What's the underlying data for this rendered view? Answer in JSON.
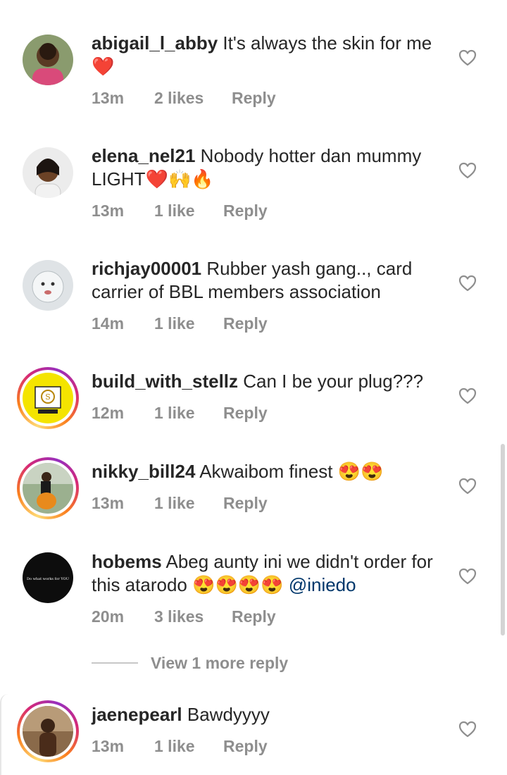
{
  "comments": [
    {
      "username": "abigail_l_abby",
      "text": " It's always the skin for me❤️",
      "time": "13m",
      "likes": "2 likes",
      "reply": "Reply"
    },
    {
      "username": "elena_nel21",
      "text": " Nobody hotter dan mummy LIGHT❤️🙌🔥",
      "time": "13m",
      "likes": "1 like",
      "reply": "Reply"
    },
    {
      "username": "richjay00001",
      "text": " Rubber yash gang.., card carrier of BBL members association",
      "time": "14m",
      "likes": "1 like",
      "reply": "Reply"
    },
    {
      "username": "build_with_stellz",
      "text": " Can I be your plug???",
      "time": "12m",
      "likes": "1 like",
      "reply": "Reply"
    },
    {
      "username": "nikky_bill24",
      "text": " Akwaibom finest 😍😍",
      "time": "13m",
      "likes": "1 like",
      "reply": "Reply"
    },
    {
      "username": "hobems",
      "text": " Abeg aunty ini we didn't order for this atarodo 😍😍😍😍 ",
      "mention": "@iniedo",
      "time": "20m",
      "likes": "3 likes",
      "reply": "Reply",
      "avatar_text": "Do what works for YOU"
    },
    {
      "username": "jaenepearl",
      "text": " Bawdyyyy",
      "time": "13m",
      "likes": "1 like",
      "reply": "Reply"
    }
  ],
  "view_more_replies": "View 1 more reply",
  "colors": {
    "text": "#262626",
    "muted": "#8e8e8e",
    "mention": "#00376b",
    "heart_emoji": "#e01b24"
  },
  "icons": {
    "like": "heart-outline-icon"
  }
}
